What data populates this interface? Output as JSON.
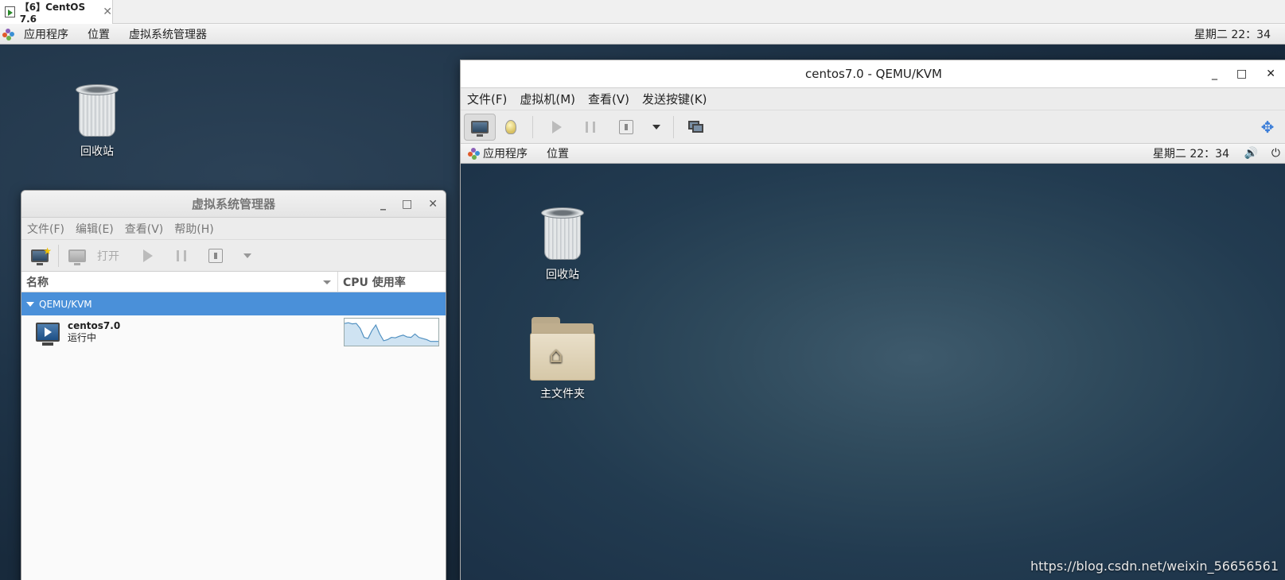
{
  "host_tab": {
    "label": "【6】CentOS 7.6",
    "close": "✕"
  },
  "gnome_bar": {
    "applications": "应用程序",
    "places": "位置",
    "virt_manager": "虚拟系统管理器",
    "clock": "星期二 22：34"
  },
  "desktop": {
    "trash_label": "回收站"
  },
  "virt_manager": {
    "title": "虚拟系统管理器",
    "controls": {
      "minimize": "_",
      "maximize": "□",
      "close": "✕"
    },
    "menu": [
      "文件(F)",
      "编辑(E)",
      "查看(V)",
      "帮助(H)"
    ],
    "toolbar": {
      "open_label": "打开"
    },
    "columns": {
      "name": "名称",
      "cpu": "CPU 使用率"
    },
    "group": "QEMU/KVM",
    "vm": {
      "name": "centos7.0",
      "status": "运行中"
    },
    "cpu_history": [
      0.92,
      0.95,
      0.9,
      0.92,
      0.7,
      0.3,
      0.25,
      0.6,
      0.85,
      0.45,
      0.15,
      0.2,
      0.3,
      0.28,
      0.35,
      0.4,
      0.32,
      0.3,
      0.45,
      0.3,
      0.25,
      0.2,
      0.12,
      0.12,
      0.12
    ]
  },
  "qemu_window": {
    "title": "centos7.0 - QEMU/KVM",
    "controls": {
      "minimize": "_",
      "maximize": "□",
      "close": "✕"
    },
    "menu": [
      "文件(F)",
      "虚拟机(M)",
      "查看(V)",
      "发送按键(K)"
    ],
    "guest_bar": {
      "applications": "应用程序",
      "places": "位置",
      "clock": "星期二 22：34"
    },
    "desktop": {
      "trash_label": "回收站",
      "home_label": "主文件夹"
    }
  },
  "watermark": "https://blog.csdn.net/weixin_56656561",
  "colors": {
    "selection_blue": "#4a90d9",
    "accent_blue": "#3b7dd8"
  }
}
